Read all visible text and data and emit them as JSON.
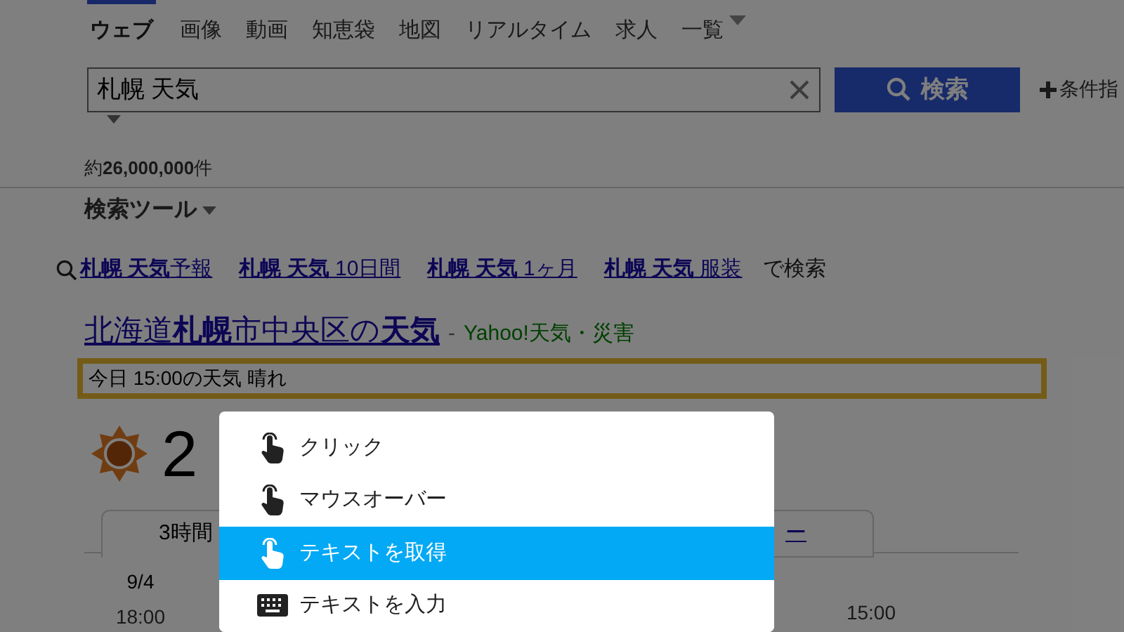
{
  "nav_tabs": [
    {
      "label": "ウェブ",
      "selected": true
    },
    {
      "label": "画像",
      "selected": false
    },
    {
      "label": "動画",
      "selected": false
    },
    {
      "label": "知恵袋",
      "selected": false
    },
    {
      "label": "地図",
      "selected": false
    },
    {
      "label": "リアルタイム",
      "selected": false
    },
    {
      "label": "求人",
      "selected": false
    },
    {
      "label": "一覧",
      "selected": false,
      "kind": "dropdown"
    }
  ],
  "search": {
    "value": "札幌 天気",
    "button": "検索",
    "conditions": "条件指"
  },
  "result_count": "約**26,000,000**件",
  "search_tools": "検索ツール",
  "related": {
    "links": [
      "**札幌 天気**予報",
      "**札幌 天気** 10日間",
      "**札幌 天気** 1ヶ月",
      "**札幌 天気** 服装"
    ],
    "suffix": "で検索"
  },
  "result": {
    "title": "北海道**札幌**市中央区の**天気**",
    "separator": "-",
    "source": "Yahoo!天気・災害",
    "snippet": "今日 15:00の天気 晴れ",
    "highlighted": true,
    "temperature": "2"
  },
  "forecast_tabs": [
    {
      "label": "3時間"
    },
    {
      "label": "ー"
    }
  ],
  "forecast": {
    "date": "9/4",
    "times": [
      "18:00",
      "15:00"
    ]
  },
  "context_menu": [
    {
      "label": "クリック",
      "kind": "pointer",
      "selected": false
    },
    {
      "label": "マウスオーバー",
      "kind": "pointer",
      "selected": false
    },
    {
      "label": "テキストを取得",
      "kind": "pointer",
      "selected": true
    },
    {
      "label": "テキストを入力",
      "kind": "keyboard",
      "selected": false
    }
  ]
}
